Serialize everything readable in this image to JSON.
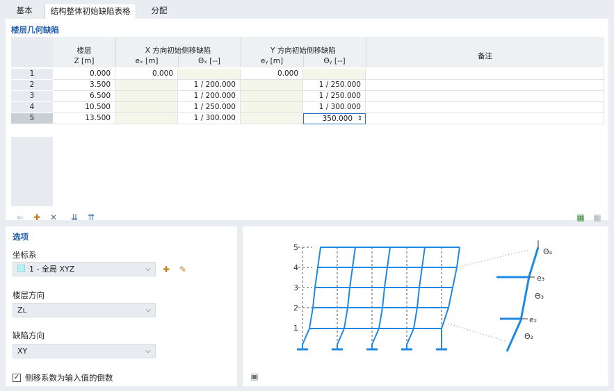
{
  "tabs": [
    {
      "label": "基本",
      "active": false
    },
    {
      "label": "结构整体初始缺陷表格",
      "active": true
    },
    {
      "label": "分配",
      "active": false
    }
  ],
  "table_section": {
    "title": "楼层几何缺陷",
    "headers": {
      "story_top": "楼层",
      "story_unit": "Z [m]",
      "x_group": "X 方向初始侧移缺陷",
      "x_e": "eₓ [m]",
      "x_theta": "Θₓ [--]",
      "y_group": "Y 方向初始侧移缺陷",
      "y_e": "eᵧ [m]",
      "y_theta": "Θᵧ [--]",
      "note": "备注"
    },
    "rows": [
      {
        "no": "1",
        "z": "0.000",
        "ex": "0.000",
        "thx": "",
        "ey": "0.000",
        "thy": "",
        "note": ""
      },
      {
        "no": "2",
        "z": "3.500",
        "ex": "",
        "thx": "1 / 200.000",
        "ey": "",
        "thy": "1 / 250.000",
        "note": ""
      },
      {
        "no": "3",
        "z": "6.500",
        "ex": "",
        "thx": "1 / 200.000",
        "ey": "",
        "thy": "1 / 250.000",
        "note": ""
      },
      {
        "no": "4",
        "z": "10.500",
        "ex": "",
        "thx": "1 / 250.000",
        "ey": "",
        "thy": "1 / 300.000",
        "note": ""
      },
      {
        "no": "5",
        "z": "13.500",
        "ex": "",
        "thx": "1 / 300.000",
        "ey": "",
        "thy": "350.000",
        "note": ""
      }
    ],
    "selected_row": "5"
  },
  "options": {
    "title": "选项",
    "coord_label": "坐标系",
    "coord_value": "1 - 全局 XYZ",
    "story_dir_label": "楼层方向",
    "story_dir_value": "Zʟ",
    "imperf_dir_label": "缺陷方向",
    "imperf_dir_value": "XY",
    "checkbox_label": "侧移系数为输入值的倒数",
    "checkbox_checked": true
  },
  "figure": {
    "levels": [
      "1",
      "2",
      "3",
      "4",
      "5"
    ],
    "e_labels": [
      "e₃",
      "e₂"
    ],
    "theta_labels": [
      "Θ₄",
      "Θ₃",
      "Θ₂"
    ]
  },
  "colors": {
    "accent": "#1f5fa8",
    "frame": "#1e88e5"
  }
}
